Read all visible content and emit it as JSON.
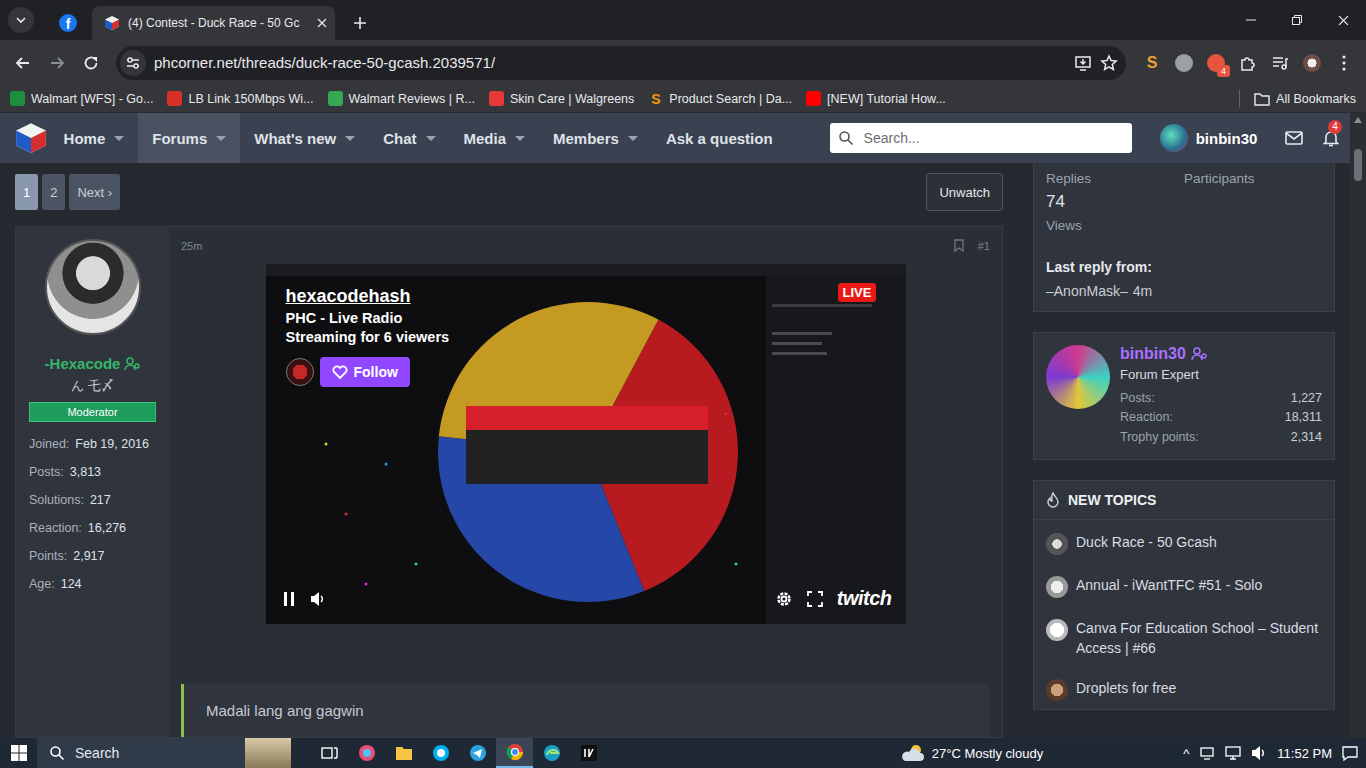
{
  "browser": {
    "tabs": [
      {
        "kind": "pinned",
        "glyph": "f",
        "selected": false
      },
      {
        "kind": "page",
        "label": "(4) Contest - Duck Race - 50 Gc",
        "selected": true
      }
    ],
    "url": "phcorner.net/threads/duck-race-50-gcash.2039571/",
    "extensions": [
      {
        "kind": "glyph",
        "glyph": "S",
        "color": "#f0a030"
      },
      {
        "kind": "dot",
        "color": "#9aa0a6"
      },
      {
        "kind": "badge",
        "badge": "4",
        "color": "#e8553e"
      }
    ],
    "bookmarks": [
      {
        "label": "Walmart [WFS] - Go...",
        "color": "#1e8e3e"
      },
      {
        "label": "LB Link 150Mbps Wi...",
        "color": "#d93025"
      },
      {
        "label": "Walmart Reviews | R...",
        "color": "#34a853"
      },
      {
        "label": "Skin Care | Walgreens",
        "color": "#e53935"
      },
      {
        "label": "Product Search | Da...",
        "color": "#f29900",
        "glyph": "S"
      },
      {
        "label": "[NEW] Tutorial How...",
        "color": "#ff0000"
      }
    ],
    "all_bookmarks": "All Bookmarks"
  },
  "site": {
    "nav": [
      {
        "label": "Home",
        "selected": false,
        "has_menu": true
      },
      {
        "label": "Forums",
        "selected": true,
        "has_menu": true
      },
      {
        "label": "What's new",
        "selected": false,
        "has_menu": true
      },
      {
        "label": "Chat",
        "selected": false,
        "has_menu": true
      },
      {
        "label": "Media",
        "selected": false,
        "has_menu": true
      },
      {
        "label": "Members",
        "selected": false,
        "has_menu": true
      },
      {
        "label": "Ask a question",
        "selected": false,
        "has_menu": false
      }
    ],
    "search": {
      "placeholder": "Search..."
    },
    "user": "binbin30",
    "alerts": "4"
  },
  "thread": {
    "pages": [
      {
        "label": "1",
        "selected": true
      },
      {
        "label": "2",
        "selected": false
      }
    ],
    "next": "Next ›",
    "unwatch": "Unwatch",
    "post": {
      "time": "25m",
      "number": "#1",
      "author": {
        "name": "-Hexacode",
        "tagline": "ん 乇〆",
        "role": "Moderator",
        "stats": [
          {
            "label": "Joined:",
            "value": "Feb 19, 2016"
          },
          {
            "label": "Posts:",
            "value": "3,813"
          },
          {
            "label": "Solutions:",
            "value": "217"
          },
          {
            "label": "Reaction:",
            "value": "16,276"
          },
          {
            "label": "Points:",
            "value": "2,917"
          },
          {
            "label": "Age:",
            "value": "124"
          }
        ]
      },
      "stream": {
        "channel": "hexacodehash",
        "title": "PHC - Live Radio",
        "status": "Streaming for 6 viewers",
        "follow": "Follow",
        "live": "LIVE",
        "logo": "twitch"
      },
      "quote": "Madali lang ang gagwin"
    }
  },
  "sidebar": {
    "stats": [
      {
        "label": "Replies"
      },
      {
        "label": "Participants"
      },
      {
        "value": "74",
        "label": "Views"
      }
    ],
    "last_reply": {
      "label": "Last reply from:",
      "user": "–AnonMask–",
      "time": "4m"
    },
    "profile": {
      "name": "binbin30",
      "title": "Forum Expert",
      "stats": [
        {
          "label": "Posts:",
          "value": "1,227"
        },
        {
          "label": "Reaction:",
          "value": "18,311"
        },
        {
          "label": "Trophy points:",
          "value": "2,314"
        }
      ]
    },
    "new_topics": {
      "title": "NEW TOPICS",
      "items": [
        "Duck Race - 50 Gcash",
        "Annual - iWantTFC #51 - Solo",
        "Canva For Education School – Student Access | #66",
        "Droplets for free"
      ]
    }
  },
  "taskbar": {
    "search": "Search",
    "weather": "27°C Mostly cloudy",
    "tray_chevron": "^",
    "time": "11:52 PM"
  }
}
